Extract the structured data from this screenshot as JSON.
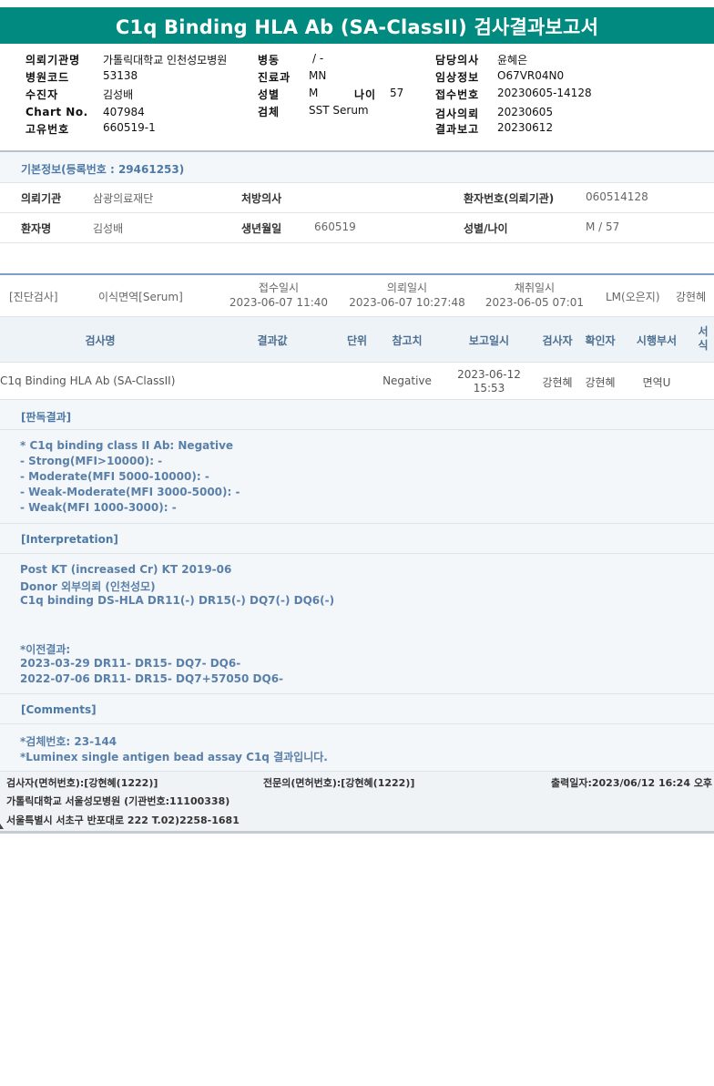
{
  "title": "C1q Binding HLA Ab (SA-ClassII) 검사결과보고서",
  "header": {
    "ordering_inst_label": "의뢰기관명",
    "ordering_inst": "가톨릭대학교 인천성모병원",
    "hosp_code_label": "병원코드",
    "hosp_code": "53138",
    "recipient_label": "수진자",
    "recipient": "김성배",
    "chart_label": "Chart No.",
    "chart": "407984",
    "unique_label": "고유번호",
    "unique": "660519-1",
    "ward_label": "병동",
    "ward": "/ -",
    "dept_label": "진료과",
    "dept": "MN",
    "sex_label": "성별",
    "sex": "M",
    "age_label": "나이",
    "age": "57",
    "specimen_label": "검체",
    "specimen": "SST Serum",
    "doctor_label": "담당의사",
    "doctor": "윤혜은",
    "clinical_label": "임상정보",
    "clinical": "O67VR04N0",
    "accession_label": "접수번호",
    "accession": "20230605-14128",
    "requested_label": "검사의뢰",
    "requested": "20230605",
    "reported_label": "결과보고",
    "reported": "20230612"
  },
  "basic": {
    "heading": "기본정보(등록번호 : 29461253)",
    "inst_label": "의뢰기관",
    "inst": "삼광의료재단",
    "prescriber_label": "처방의사",
    "prescriber": "",
    "patient_no_label": "환자번호(의뢰기관)",
    "patient_no": "060514128",
    "name_label": "환자명",
    "name": "김성배",
    "dob_label": "생년월일",
    "dob": "660519",
    "sexage_label": "성별/나이",
    "sexage": "M / 57"
  },
  "exam": {
    "category": "[진단검사]",
    "test_group": "이식면역[Serum]",
    "received_label": "접수일시",
    "received": "2023-06-07 11:40",
    "requested_label": "의뢰일시",
    "requested": "2023-06-07 10:27:48",
    "collected_label": "채취일시",
    "collected": "2023-06-05 07:01",
    "lm": "LM(오은지)",
    "examiner": "강현혜"
  },
  "table": {
    "headers": [
      "검사명",
      "결과값",
      "단위",
      "참고치",
      "보고일시",
      "검사자",
      "확인자",
      "시행부서",
      "서식"
    ],
    "row": {
      "name": "C1q Binding HLA Ab (SA-ClassII)",
      "result": "",
      "unit": "",
      "reference": "Negative",
      "report_date": "2023-06-12",
      "report_time": "15:53",
      "examiner": "강현혜",
      "verifier": "강현혜",
      "dept": "면역U",
      "form": ""
    }
  },
  "sections": {
    "judgement_title": "[판독결과]",
    "judgement_lines": [
      "* C1q binding class II Ab: Negative",
      "- Strong(MFI>10000): -",
      "- Moderate(MFI 5000-10000): -",
      "- Weak-Moderate(MFI 3000-5000): -",
      "- Weak(MFI 1000-3000): -"
    ],
    "interp_title": "[Interpretation]",
    "interp_lines": [
      "Post KT (increased Cr) KT 2019-06",
      "Donor 외부의뢰 (인천성모)",
      "C1q binding DS-HLA DR11(-) DR15(-) DQ7(-) DQ6(-)"
    ],
    "prev_lines": [
      "*이전결과:",
      "2023-03-29 DR11- DR15- DQ7- DQ6-",
      "2022-07-06 DR11- DR15- DQ7+57050 DQ6-"
    ],
    "comments_title": "[Comments]",
    "comments_lines": [
      "*검체번호: 23-144",
      "*Luminex single antigen bead assay C1q 결과입니다."
    ]
  },
  "footer": {
    "examiner": "검사자(면허번호):[강현혜(1222)]",
    "specialist": "전문의(면허번호):[강현혜(1222)]",
    "printed": "출력일자:2023/06/12 16:24 오후",
    "hospital": "가톨릭대학교 서울성모병원 (기관번호:11100338)",
    "address": "서울특별시 서초구 반포대로 222 T.02)2258-1681"
  }
}
